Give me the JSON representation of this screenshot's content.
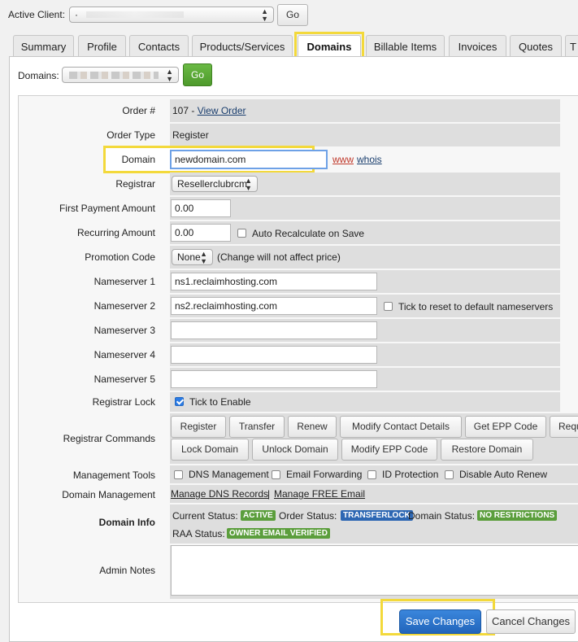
{
  "topbar": {
    "active_client_label": "Active Client:",
    "client_select_value": "·",
    "go_label": "Go"
  },
  "tabs": [
    {
      "label": "Summary"
    },
    {
      "label": "Profile"
    },
    {
      "label": "Contacts"
    },
    {
      "label": "Products/Services"
    },
    {
      "label": "Domains"
    },
    {
      "label": "Billable Items"
    },
    {
      "label": "Invoices"
    },
    {
      "label": "Quotes"
    },
    {
      "label": "T"
    }
  ],
  "domains_bar": {
    "label": "Domains:",
    "go_label": "Go"
  },
  "form": {
    "order_number": {
      "label": "Order #",
      "value": "107 - ",
      "link": "View Order"
    },
    "order_type": {
      "label": "Order Type",
      "value": "Register"
    },
    "domain": {
      "label": "Domain",
      "value": "newdomain.com",
      "www_link": "www",
      "whois_link": "whois"
    },
    "registrar": {
      "label": "Registrar",
      "value": "Resellerclubrcm"
    },
    "first_payment": {
      "label": "First Payment Amount",
      "value": "0.00"
    },
    "recurring": {
      "label": "Recurring Amount",
      "value": "0.00",
      "auto_recalc": "Auto Recalculate on Save"
    },
    "promotion": {
      "label": "Promotion Code",
      "value": "None",
      "note": "(Change will not affect price)"
    },
    "ns1": {
      "label": "Nameserver 1",
      "value": "ns1.reclaimhosting.com"
    },
    "ns2": {
      "label": "Nameserver 2",
      "value": "ns2.reclaimhosting.com",
      "reset": "Tick to reset to default nameservers"
    },
    "ns3": {
      "label": "Nameserver 3",
      "value": ""
    },
    "ns4": {
      "label": "Nameserver 4",
      "value": ""
    },
    "ns5": {
      "label": "Nameserver 5",
      "value": ""
    },
    "registrar_lock": {
      "label": "Registrar Lock",
      "checkbox": "Tick to Enable",
      "checked": true
    },
    "registrar_commands": {
      "label": "Registrar Commands",
      "row1": [
        "Register",
        "Transfer",
        "Renew",
        "Modify Contact Details",
        "Get EPP Code",
        "Request"
      ],
      "row2": [
        "Lock Domain",
        "Unlock Domain",
        "Modify EPP Code",
        "Restore Domain"
      ]
    },
    "management_tools": {
      "label": "Management Tools",
      "options": [
        "DNS Management",
        "Email Forwarding",
        "ID Protection",
        "Disable Auto Renew"
      ]
    },
    "domain_management": {
      "label": "Domain Management",
      "link1": "Manage DNS Records",
      "separator": "|",
      "link2": "Manage FREE Email"
    },
    "domain_info": {
      "label": "Domain Info",
      "current_status_label": "Current Status:",
      "current_status": "ACTIVE",
      "order_status_label": "Order Status:",
      "order_status": "TRANSFERLOCK",
      "domain_status_label": "Domain Status:",
      "domain_status": "NO RESTRICTIONS",
      "raa_status_label": "RAA Status:",
      "raa_status": "OWNER EMAIL VERIFIED"
    },
    "admin_notes": {
      "label": "Admin Notes",
      "value": ""
    }
  },
  "footer": {
    "save_label": "Save Changes",
    "cancel_label": "Cancel Changes"
  },
  "colors": {
    "accent_highlight": "#f3d93b",
    "go_green": "#5fa83a",
    "save_blue": "#2a72c9",
    "badge_green": "#5b9e3c",
    "badge_blue": "#2d67b3"
  }
}
